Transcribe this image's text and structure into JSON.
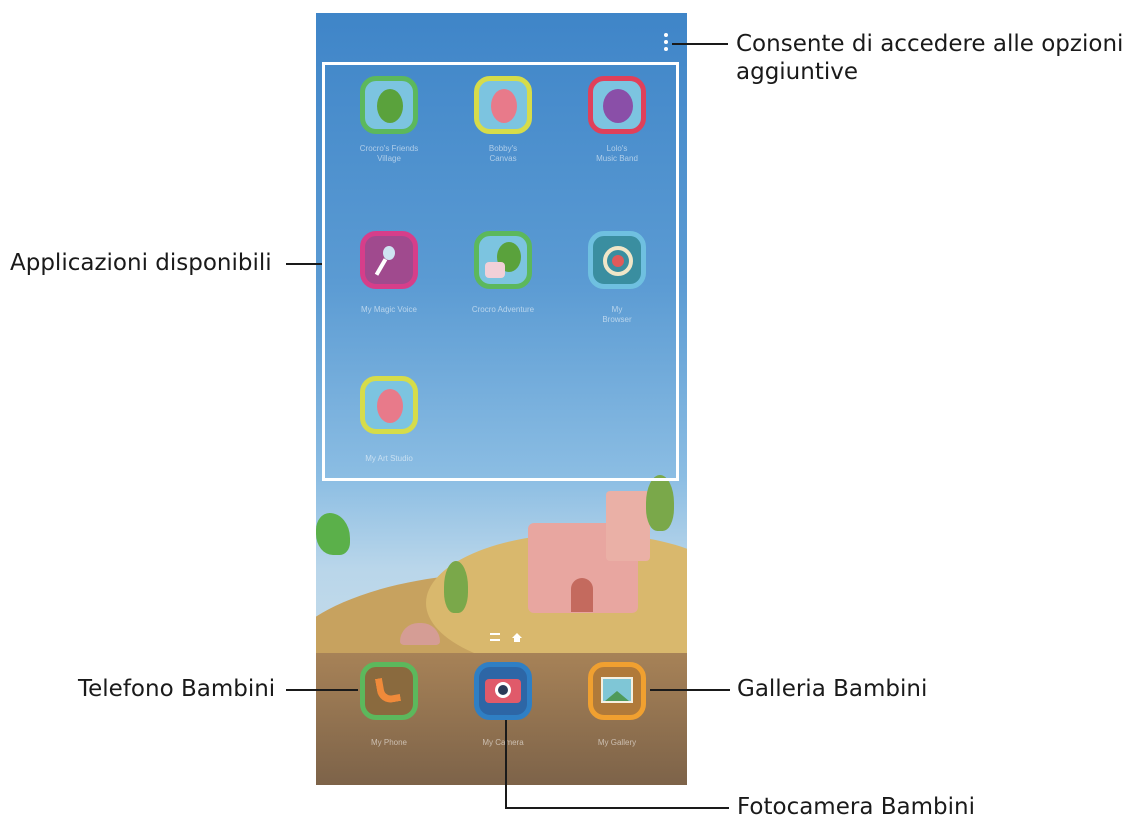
{
  "callouts": {
    "options_line1": "Consente di accedere alle opzioni",
    "options_line2": "aggiuntive",
    "available_apps": "Applicazioni disponibili",
    "kids_phone": "Telefono Bambini",
    "kids_gallery": "Galleria Bambini",
    "kids_camera": "Fotocamera Bambini"
  },
  "apps": [
    {
      "label_1": "Crocro's Friends",
      "label_2": "Village",
      "icon": "crocodile-house-icon",
      "color": "#5cb85c"
    },
    {
      "label_1": "Bobby's",
      "label_2": "Canvas",
      "icon": "pink-character-icon",
      "color": "#d6dc4a"
    },
    {
      "label_1": "Lolo's",
      "label_2": "Music Band",
      "icon": "music-character-icon",
      "color": "#e0405a"
    },
    {
      "label_1": "My Magic Voice",
      "label_2": "",
      "icon": "microphone-icon",
      "color": "#d63e8a"
    },
    {
      "label_1": "Crocro Adventure",
      "label_2": "",
      "icon": "crocodile-cake-icon",
      "color": "#5cb85c"
    },
    {
      "label_1": "My",
      "label_2": "Browser",
      "icon": "ship-wheel-icon",
      "color": "#6fc0e0"
    },
    {
      "label_1": "My Art Studio",
      "label_2": "",
      "icon": "artist-character-icon",
      "color": "#d6dc4a"
    }
  ],
  "dock": [
    {
      "label": "My Phone",
      "icon": "phone-handset-icon",
      "color": "#5cb85c"
    },
    {
      "label": "My Camera",
      "icon": "camera-icon",
      "color": "#2f7fc4"
    },
    {
      "label": "My Gallery",
      "icon": "landscape-picture-icon",
      "color": "#f0a030"
    }
  ]
}
